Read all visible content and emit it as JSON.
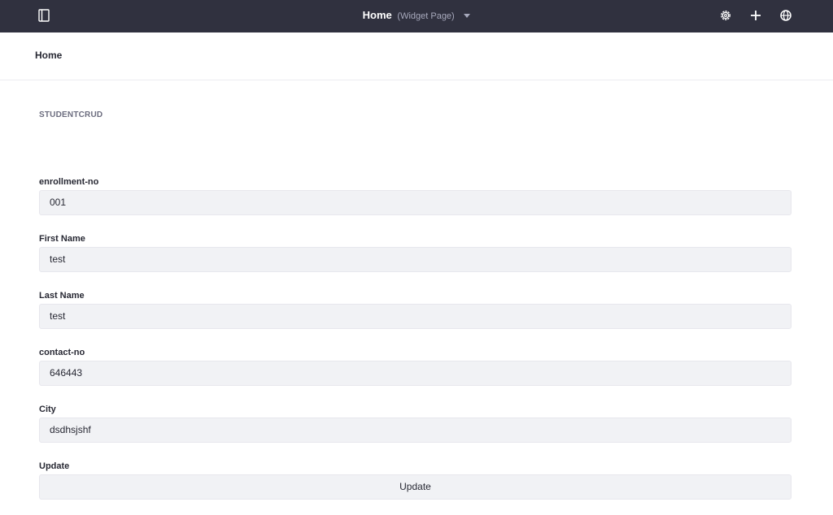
{
  "topbar": {
    "title": "Home",
    "subtitle": "(Widget Page)",
    "icons": [
      "sidebar-toggle-icon",
      "gear-icon",
      "plus-icon",
      "globe-icon"
    ],
    "background": "#30313f"
  },
  "breadcrumb": {
    "label": "Home"
  },
  "portlet": {
    "title": "STUDENTCRUD"
  },
  "form": {
    "fields": [
      {
        "label": "enrollment-no",
        "value": "001"
      },
      {
        "label": "First Name",
        "value": "test"
      },
      {
        "label": "Last Name",
        "value": "test"
      },
      {
        "label": "contact-no",
        "value": "646443"
      },
      {
        "label": "City",
        "value": "dsdhsjshf"
      }
    ],
    "update_label": "Update",
    "update_button": "Update"
  }
}
